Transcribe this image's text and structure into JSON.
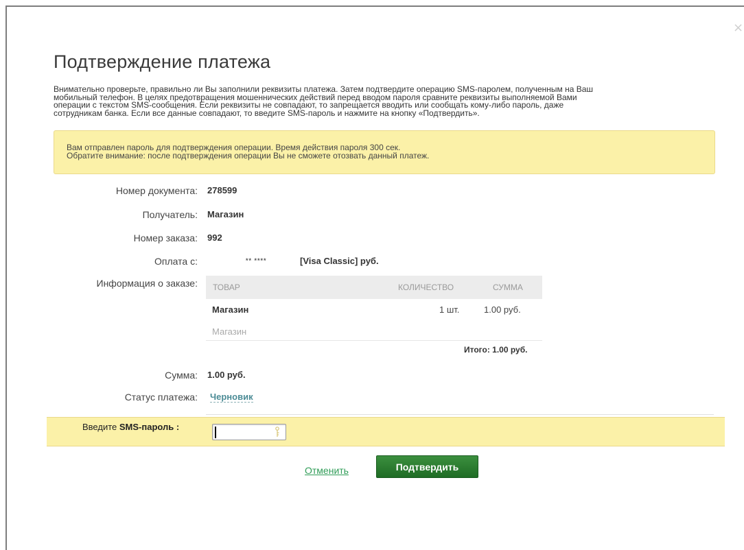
{
  "dialog": {
    "title": "Подтверждение платежа",
    "intro_lines": [
      "Внимательно проверьте, правильно ли Вы заполнили реквизиты платежа. Затем подтвердите операцию SMS-паролем, полученным на Ваш",
      "мобильный телефон. В целях предотвращения мошеннических действий перед вводом пароля сравните реквизиты выполняемой Вами",
      "операции с текстом SMS-сообщения. Если реквизиты не совпадают, то запрещается вводить или сообщать кому-либо пароль, даже",
      "сотрудникам банка. Если все данные совпадают, то введите SMS-пароль и нажмите на кнопку «Подтвердить»."
    ],
    "notice_lines": [
      "Вам отправлен пароль для подтверждения операции. Время действия пароля 300 сек.",
      "Обратите внимание: после подтверждения операции Вы не сможете отозвать данный платеж."
    ],
    "close_glyph": "×"
  },
  "details": {
    "doc_number_label": "Номер документа:",
    "doc_number": "278599",
    "recipient_label": "Получатель:",
    "recipient": "Магазин",
    "order_number_label": "Номер заказа:",
    "order_number": "992",
    "pay_from_label": "Оплата с:",
    "card_mask": "** ****",
    "card_name": "[Visa Classic]  руб.",
    "order_info_label": "Информация о заказе:",
    "amount_label": "Сумма:",
    "amount": "1.00  руб.",
    "status_label": "Статус платежа:",
    "status": "Черновик"
  },
  "order_table": {
    "headers": {
      "item": "ТОВАР",
      "qty": "КОЛИЧЕСТВО",
      "sum": "СУММА"
    },
    "rows": [
      {
        "item": "Магазин",
        "qty": "1 шт.",
        "sum": "1.00  руб."
      },
      {
        "item": "Магазин",
        "qty": "",
        "sum": ""
      }
    ],
    "total": "Итого: 1.00 руб."
  },
  "sms": {
    "label_prefix": "Введите ",
    "label_bold": "SMS-пароль :",
    "value": "",
    "placeholder": ""
  },
  "actions": {
    "cancel_label": "Отменить",
    "confirm_label": "Подтвердить"
  },
  "colors": {
    "accent_green": "#2f9c57",
    "notice_yellow": "#fbf1a8",
    "status_link": "#4c8c96"
  }
}
